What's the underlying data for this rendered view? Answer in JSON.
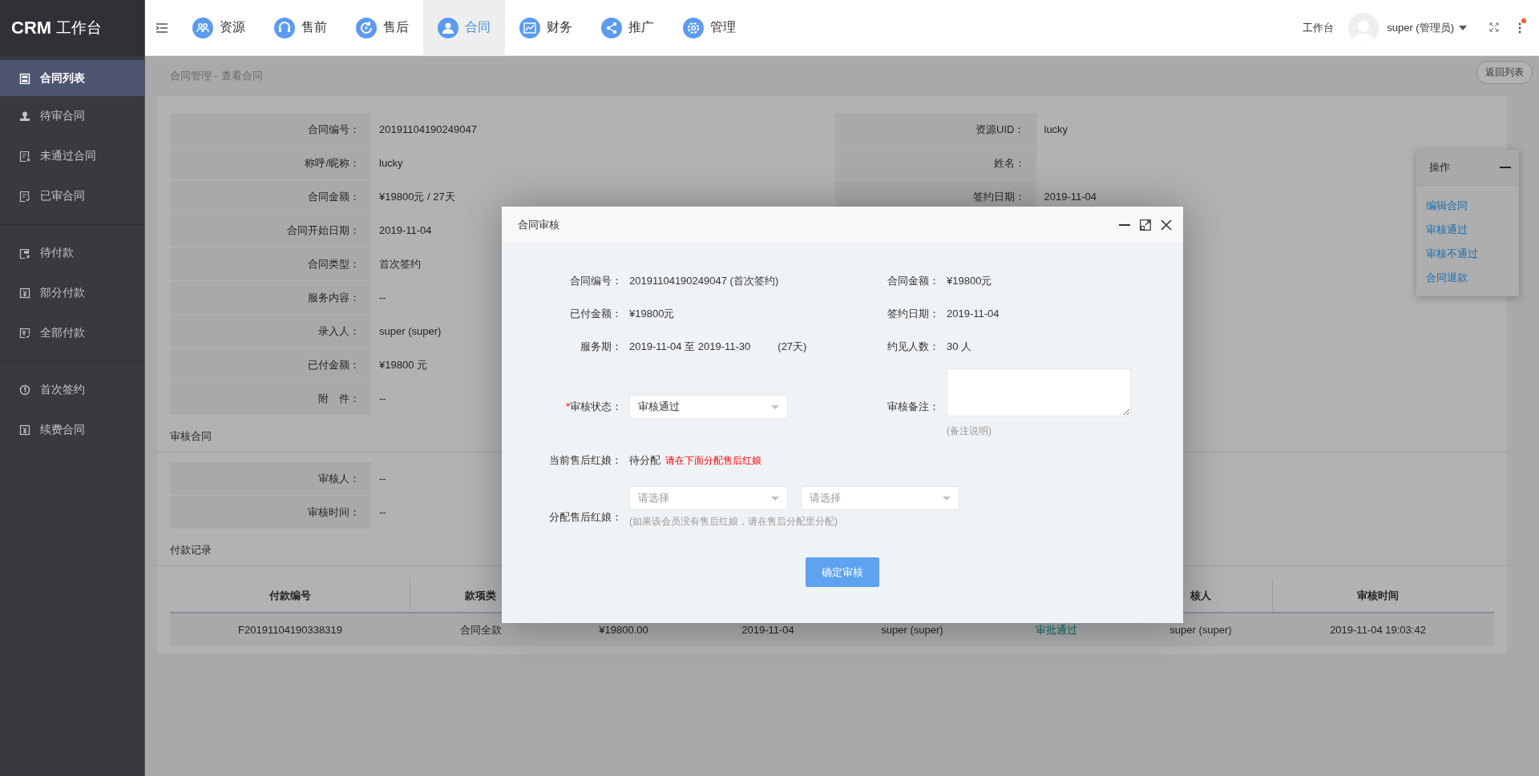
{
  "sidebar": {
    "logo": {
      "brand": "CRM",
      "title": "工作台"
    },
    "groups": [
      {
        "items": [
          {
            "label": "合同列表",
            "selected": true
          },
          {
            "label": "待审合同",
            "selected": false
          },
          {
            "label": "未通过合同",
            "selected": false
          },
          {
            "label": "已审合同",
            "selected": false
          }
        ]
      },
      {
        "items": [
          {
            "label": "待付款",
            "selected": false
          },
          {
            "label": "部分付款",
            "selected": false
          },
          {
            "label": "全部付款",
            "selected": false
          }
        ]
      },
      {
        "items": [
          {
            "label": "首次签约",
            "selected": false
          },
          {
            "label": "续费合同",
            "selected": false
          }
        ]
      }
    ]
  },
  "topbar": {
    "nav": [
      {
        "label": "资源",
        "selected": false
      },
      {
        "label": "售前",
        "selected": false
      },
      {
        "label": "售后",
        "selected": false
      },
      {
        "label": "合同",
        "selected": true
      },
      {
        "label": "财务",
        "selected": false
      },
      {
        "label": "推广",
        "selected": false
      },
      {
        "label": "管理",
        "selected": false
      }
    ],
    "workbench": "工作台",
    "user": "super (管理员)",
    "has_notification": true
  },
  "breadcrumb": "合同管理 - 查看合同",
  "back_button": "返回列表",
  "contract": {
    "left_fields": [
      {
        "label": "合同编号：",
        "value": "20191104190249047"
      },
      {
        "label": "称呼/昵称：",
        "value": "lucky"
      },
      {
        "label": "合同金额：",
        "value": "¥19800元 / 27天"
      },
      {
        "label": "合同开始日期：",
        "value": "2019-11-04"
      },
      {
        "label": "合同类型：",
        "value": "首次签约"
      },
      {
        "label": "服务内容：",
        "value": "--"
      },
      {
        "label": "录入人：",
        "value": "super (super)"
      },
      {
        "label": "已付金额：",
        "value": "¥19800 元"
      },
      {
        "label": "附　件：",
        "value": "--"
      }
    ],
    "right_fields": [
      {
        "label": "资源UID：",
        "value": "lucky"
      },
      {
        "label": "姓名："
      },
      {
        "label": "签约日期：",
        "value": "2019-11-04"
      }
    ]
  },
  "review_section": {
    "title": "审核合同",
    "fields": [
      {
        "label": "审核人：",
        "value": "--"
      },
      {
        "label": "审核时间：",
        "value": "--"
      }
    ]
  },
  "payment_section": {
    "title": "付款记录",
    "header": {
      "column_1": "付款编号",
      "column_2": "款项类",
      "column_7": "核人",
      "column_8": "审核时间"
    },
    "rows": [
      {
        "cells": [
          {
            "kind": "text",
            "text": "F20191104190338319"
          },
          {
            "kind": "text",
            "text": "合同全款"
          },
          {
            "kind": "text",
            "text": "¥19800.00"
          },
          {
            "kind": "text",
            "text": "2019-11-04"
          },
          {
            "kind": "text",
            "text": "super (super)"
          },
          {
            "kind": "status",
            "text": "审批通过"
          },
          {
            "kind": "text",
            "text": "super (super)"
          },
          {
            "kind": "text",
            "text": "2019-11-04 19:03:42"
          }
        ]
      }
    ]
  },
  "actions_panel": {
    "title": "操作",
    "links": [
      "编辑合同",
      "审核通过",
      "审核不通过",
      "合同退款"
    ]
  },
  "modal": {
    "title": "合同审核",
    "rows": [
      {
        "left": {
          "label": "合同编号：",
          "value": "20191104190249047 (首次签约)"
        },
        "right": {
          "label": "合同金额：",
          "value": "¥19800元"
        }
      },
      {
        "left": {
          "label": "已付金额：",
          "value": "¥19800元"
        },
        "right": {
          "label": "签约日期：",
          "value": "2019-11-04"
        }
      },
      {
        "left": {
          "label": "服务期：",
          "value": "2019-11-04 至 2019-11-30",
          "extra": "(27天)"
        },
        "right": {
          "label": "约见人数：",
          "value": "30 人"
        }
      }
    ],
    "status": {
      "required_mark": "*",
      "label": "审核状态：",
      "value": "审核通过"
    },
    "note": {
      "label": "审核备注：",
      "hint": "(备注说明)"
    },
    "current": {
      "label": "当前售后红娘：",
      "value": "待分配",
      "warning": "请在下面分配售后红娘"
    },
    "assign": {
      "label": "分配售后红娘：",
      "selects": [
        {
          "placeholder": "请选择"
        },
        {
          "placeholder": "请选择"
        }
      ],
      "hint": "(如果该会员没有售后红娘，请在售后分配里分配)"
    },
    "submit": "确定审核"
  }
}
